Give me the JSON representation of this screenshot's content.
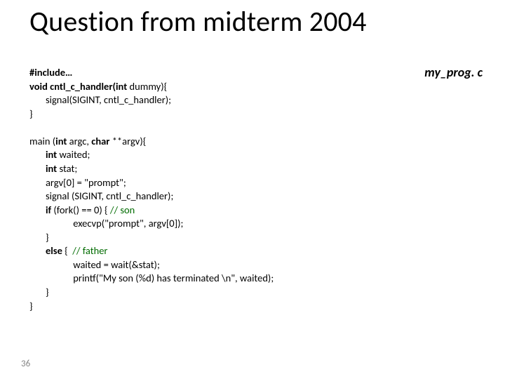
{
  "title": "Question from midterm 2004",
  "filename": "my_prog. c",
  "page_number": "36",
  "code": {
    "l1a": "#include…",
    "l2a": "void cntl_c_handler(int ",
    "l2b": "dummy){",
    "l3": "       signal(SIGINT, cntl_c_handler);",
    "l4": "}",
    "l6a": "main (",
    "l6b": "int ",
    "l6c": "argc, ",
    "l6d": "char ",
    "l6e": "**argv){",
    "l7a": "       int ",
    "l7b": "waited;",
    "l8a": "       int ",
    "l8b": "stat;",
    "l9": "       argv[0] = \"prompt\";",
    "l10": "       signal (SIGINT, cntl_c_handler);",
    "l11a": "       if ",
    "l11b": "(fork() == 0) { ",
    "l11c": "// son",
    "l12": "                   execvp(\"prompt\", argv[0]);",
    "l13": "       }",
    "l14a": "       else ",
    "l14b": "{  ",
    "l14c": "// father",
    "l15": "                   waited = wait(&stat);",
    "l16": "                   printf(\"My son (%d) has terminated \\n\", waited);",
    "l17": "       }",
    "l18": "}"
  }
}
